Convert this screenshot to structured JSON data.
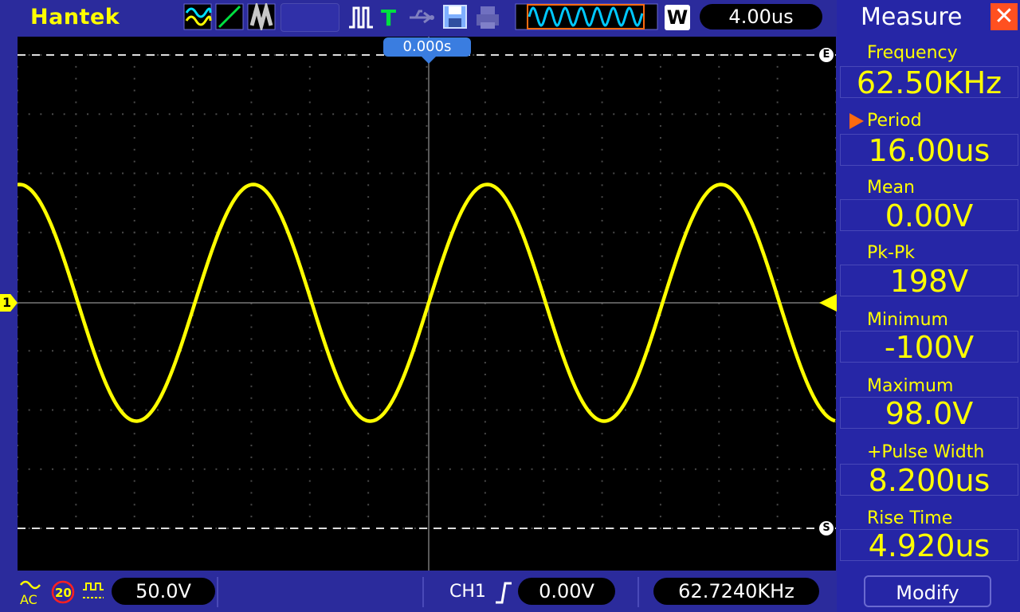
{
  "topbar": {
    "brand": "Hantek",
    "timebase": "4.00us",
    "zoom_mode": "W",
    "icons": [
      "waveform-mode-icon",
      "line-display-icon",
      "persistence-icon",
      "run-status-icon",
      "trigger-icon",
      "usb-icon",
      "save-icon",
      "print-icon",
      "memory-view-icon"
    ]
  },
  "screen": {
    "trigger_position": "0.000s",
    "channel_marker": "1",
    "upper_cursor_marker": "E",
    "lower_cursor_marker": "S",
    "grid_divisions": {
      "x": 14,
      "y": 8
    },
    "trace_color": "#ffff00",
    "waveform": {
      "type": "sine",
      "cycles_visible": 4,
      "period": "16.00us",
      "amplitude_divs": 2.0
    }
  },
  "measure": {
    "title": "Measure",
    "items": [
      {
        "label": "Frequency",
        "value": "62.50KHz",
        "selected": false
      },
      {
        "label": "Period",
        "value": "16.00us",
        "selected": true
      },
      {
        "label": "Mean",
        "value": "0.00V",
        "selected": false
      },
      {
        "label": "Pk-Pk",
        "value": "198V",
        "selected": false
      },
      {
        "label": "Minimum",
        "value": "-100V",
        "selected": false
      },
      {
        "label": "Maximum",
        "value": "98.0V",
        "selected": false
      },
      {
        "label": "+Pulse Width",
        "value": "8.200us",
        "selected": false
      },
      {
        "label": "Rise Time",
        "value": "4.920us",
        "selected": false
      }
    ],
    "modify_label": "Modify"
  },
  "bottombar": {
    "coupling": "AC",
    "bw_limit": "20",
    "probe_icon": "pulse-icon",
    "volts_div": "50.0V",
    "trigger_source": "CH1",
    "trigger_level": "0.00V",
    "trigger_freq": "62.7240KHz"
  },
  "colors": {
    "accent": "#ffff00",
    "background": "#2b2b9c",
    "screen": "#000000",
    "highlight": "#ff6a10",
    "close": "#ff5020"
  }
}
